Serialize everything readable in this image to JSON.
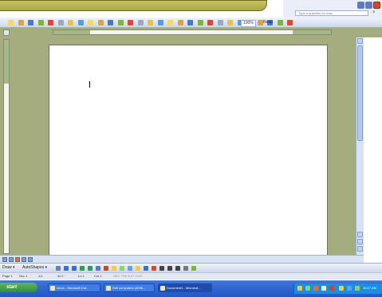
{
  "window": {
    "help_placeholder": "Type a question for help",
    "menu_close_glyph": "×"
  },
  "toolbar": {
    "zoom": "100%",
    "read_label": "Read",
    "icon_names": [
      "new-icon",
      "open-icon",
      "save-icon",
      "permission-icon",
      "email-icon",
      "print-icon",
      "print-preview-icon",
      "spelling-icon",
      "research-icon",
      "cut-icon",
      "copy-icon",
      "paste-icon",
      "format-painter-icon",
      "undo-icon",
      "redo-icon",
      "hyperlink-icon",
      "tables-borders-icon",
      "insert-table-icon",
      "insert-excel-icon",
      "columns-icon",
      "drawing-icon",
      "document-map-icon",
      "show-hide-icon",
      "zoom-icon",
      "help-icon",
      "bold-icon",
      "highlight-icon",
      "font-color-icon",
      "bullets-icon"
    ]
  },
  "drawbar": {
    "draw_label": "Draw ▾",
    "autoshapes_label": "AutoShapes ▾"
  },
  "statusbar": {
    "page": "Page 1",
    "sec": "Sec 1",
    "pages": "1/1",
    "at": "At 1\"",
    "ln": "Ln 1",
    "col": "Col 1",
    "modes": "REC  TRK  EXT  OVR"
  },
  "taskbar": {
    "start_label": "start",
    "tasks": [
      {
        "label": "Inbox - Microsoft Out...",
        "active": false
      },
      {
        "label": "Dell computers (4096...",
        "active": false
      },
      {
        "label": "Document1 - Microsof...",
        "active": true
      }
    ],
    "clock": "10:27 AM"
  },
  "colors": {
    "workspace": "#a5ad7f",
    "taskbar": "#2357c4",
    "start": "#338f34",
    "tray": "#1690e6"
  }
}
